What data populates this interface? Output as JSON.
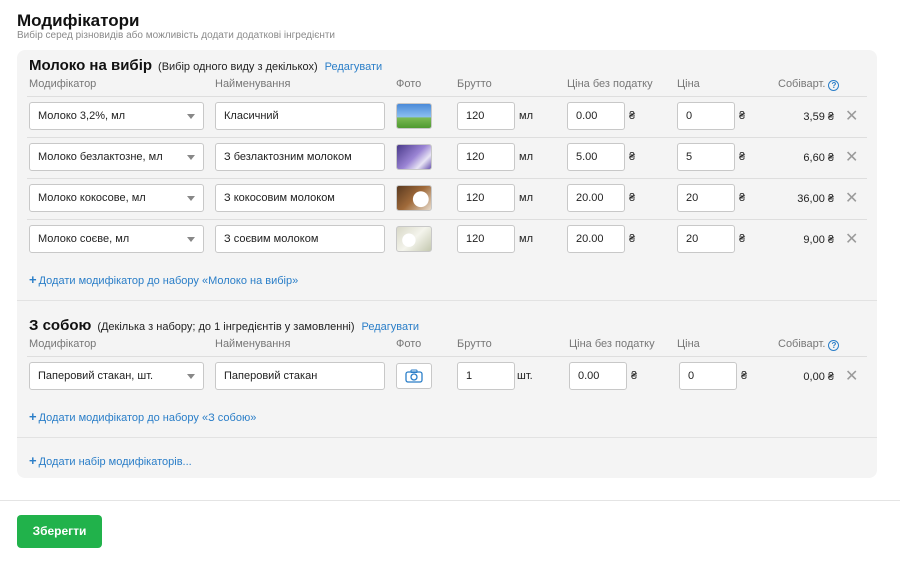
{
  "title": "Модифікатори",
  "subtitle": "Вибір серед різновидів або можливість додати додаткові інгредієнти",
  "columns": {
    "modifier": "Модифікатор",
    "name": "Найменування",
    "photo": "Фото",
    "brutto": "Брутто",
    "price_no_tax": "Ціна без податку",
    "price": "Ціна",
    "cost": "Собіварт."
  },
  "icons": {
    "help": "?",
    "remove": "✕",
    "camera": "camera-icon",
    "dropdown": "chevron-down-icon",
    "plus": "+"
  },
  "groups": [
    {
      "name": "Молоко на вибір",
      "description": "(Вибір одного виду з декількох)",
      "edit_label": "Редагувати",
      "add_label": "Додати модифікатор до набору «Молоко на вибір»",
      "rows": [
        {
          "modifier": "Молоко 3,2%, мл",
          "name": "Класичний",
          "brutto": "120",
          "unit": "мл",
          "price_no_tax": "0.00",
          "price": "0",
          "currency": "₴",
          "cost": "3,59 ₴"
        },
        {
          "modifier": "Молоко безлактозне, мл",
          "name": "З безлактозним молоком",
          "brutto": "120",
          "unit": "мл",
          "price_no_tax": "5.00",
          "price": "5",
          "currency": "₴",
          "cost": "6,60 ₴"
        },
        {
          "modifier": "Молоко кокосове, мл",
          "name": "З кокосовим молоком",
          "brutto": "120",
          "unit": "мл",
          "price_no_tax": "20.00",
          "price": "20",
          "currency": "₴",
          "cost": "36,00 ₴"
        },
        {
          "modifier": "Молоко соєве, мл",
          "name": "З соєвим молоком",
          "brutto": "120",
          "unit": "мл",
          "price_no_tax": "20.00",
          "price": "20",
          "currency": "₴",
          "cost": "9,00 ₴"
        }
      ]
    },
    {
      "name": "З собою",
      "description": "(Декілька з набору; до 1 інгредієнтів у замовленні)",
      "edit_label": "Редагувати",
      "add_label": "Додати модифікатор до набору «З собою»",
      "rows": [
        {
          "modifier": "Паперовий стакан, шт.",
          "name": "Паперовий стакан",
          "brutto": "1",
          "unit": "шт.",
          "price_no_tax": "0.00",
          "price": "0",
          "currency": "₴",
          "cost": "0,00 ₴"
        }
      ]
    }
  ],
  "add_set_label": "Додати набір модифікаторів...",
  "save_label": "Зберегти",
  "colors": {
    "accent": "#2a7ec8",
    "save": "#21b24b",
    "panel": "#f4f4f4"
  }
}
